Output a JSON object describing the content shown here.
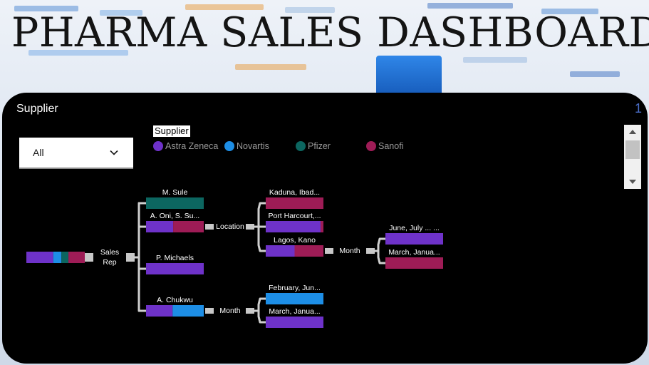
{
  "dashboard_title": "PHARMA SALES DASHBOARD",
  "panel": {
    "title": "Supplier",
    "page_indicator": "1"
  },
  "filter": {
    "selected": "All",
    "chevron_icon": "chevron-down-icon"
  },
  "legend": {
    "title": "Supplier",
    "items": [
      {
        "label": "Astra Zeneca",
        "color": "#6e32c9"
      },
      {
        "label": "Novartis",
        "color": "#1d8ee6"
      },
      {
        "label": "Pfizer",
        "color": "#0c6660"
      },
      {
        "label": "Sanofi",
        "color": "#9e1c56"
      }
    ]
  },
  "tree": {
    "root_label": "Sales Rep",
    "rep_split_label": "Location",
    "location_split_label": "Month",
    "chukwu_split_label": "Month",
    "reps": [
      {
        "name": "M. Sule",
        "shares": {
          "Pfizer": 1.0
        }
      },
      {
        "name": "A. Oni, S. Su...",
        "shares": {
          "Astra Zeneca": 0.47,
          "Sanofi": 0.53
        }
      },
      {
        "name": "P. Michaels",
        "shares": {
          "Astra Zeneca": 1.0
        }
      },
      {
        "name": "A. Chukwu",
        "shares": {
          "Astra Zeneca": 0.46,
          "Novartis": 0.54
        }
      }
    ],
    "locations": [
      {
        "name": "Kaduna, Ibad...",
        "shares": {
          "Sanofi": 1.0
        }
      },
      {
        "name": "Port Harcourt,...",
        "shares": {
          "Astra Zeneca": 0.95,
          "Sanofi": 0.05
        }
      },
      {
        "name": "Lagos, Kano",
        "shares": {
          "Astra Zeneca": 0.5,
          "Sanofi": 0.5
        }
      }
    ],
    "lagos_months": [
      {
        "name": "June, July ... ...",
        "shares": {
          "Astra Zeneca": 1.0
        }
      },
      {
        "name": "March, Janua...",
        "shares": {
          "Sanofi": 1.0
        }
      }
    ],
    "chukwu_months": [
      {
        "name": "February, Jun...",
        "shares": {
          "Novartis": 1.0
        }
      },
      {
        "name": "March, Janua...",
        "shares": {
          "Astra Zeneca": 1.0
        }
      }
    ],
    "root_shares": {
      "Astra Zeneca": 0.46,
      "Novartis": 0.14,
      "Pfizer": 0.12,
      "Sanofi": 0.28
    }
  }
}
